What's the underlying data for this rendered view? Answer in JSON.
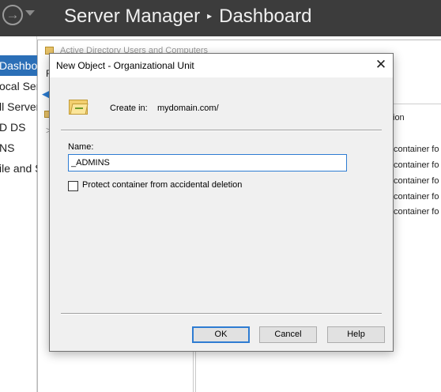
{
  "server_manager": {
    "title_app": "Server Manager",
    "title_page": "Dashboard",
    "separator": "▸",
    "back_glyph": "→",
    "sidebar": [
      {
        "label": "Dashboa",
        "active": true
      },
      {
        "label": "ocal Ser",
        "active": false
      },
      {
        "label": "ll Server",
        "active": false
      },
      {
        "label": "D DS",
        "active": false
      },
      {
        "label": "NS",
        "active": false
      },
      {
        "label": "ile and S",
        "active": false
      }
    ]
  },
  "aduc": {
    "title": "Active Directory Users and Computers",
    "menu_first": "F",
    "back_arrow": "◀",
    "tree_chevron": ">",
    "list_header": "ion",
    "rows": [
      "container fo",
      "container fo",
      "container fo",
      "container fo",
      "container fo"
    ]
  },
  "dialog": {
    "title": "New Object - Organizational Unit",
    "close": "✕",
    "create_in_label": "Create in:",
    "create_in_value": "mydomain.com/",
    "name_label": "Name:",
    "name_value": "_ADMINS",
    "protect_label": "Protect container from accidental deletion",
    "protect_checked": false,
    "buttons": {
      "ok": "OK",
      "cancel": "Cancel",
      "help": "Help"
    }
  },
  "colors": {
    "titlebar": "#3c3c3c",
    "accent": "#2b6fb7",
    "dialog_bg": "#f0f0f0"
  }
}
